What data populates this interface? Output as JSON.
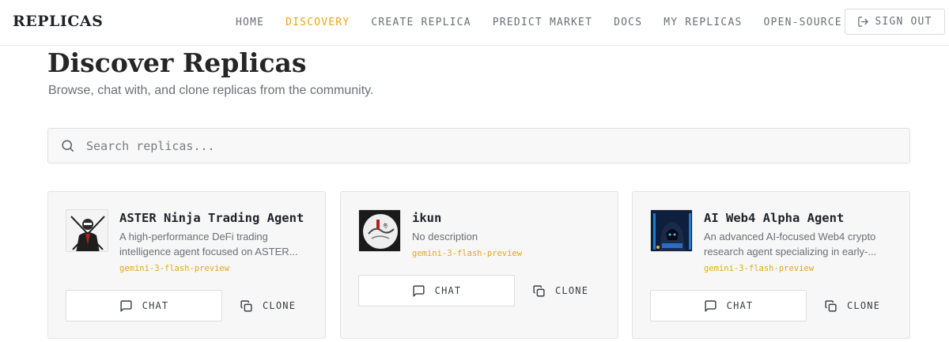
{
  "header": {
    "brand": "REPLICAS",
    "nav": [
      {
        "label": "HOME",
        "active": false
      },
      {
        "label": "DISCOVERY",
        "active": true
      },
      {
        "label": "CREATE REPLICA",
        "active": false
      },
      {
        "label": "PREDICT MARKET",
        "active": false
      },
      {
        "label": "DOCS",
        "active": false
      },
      {
        "label": "MY REPLICAS",
        "active": false
      },
      {
        "label": "OPEN-SOURCE",
        "active": false
      }
    ],
    "signout_label": "SIGN OUT",
    "signout_icon": "log-out-icon"
  },
  "page": {
    "title": "Discover Replicas",
    "subtitle": "Browse, chat with, and clone replicas from the community."
  },
  "search": {
    "placeholder": "Search replicas...",
    "value": "",
    "icon": "search-icon"
  },
  "cards": [
    {
      "name": "ASTER Ninja Trading Agent",
      "description": "A high-performance DeFi trading intelligence agent focused on ASTER...",
      "model": "gemini-3-flash-preview",
      "avatar_icon": "ninja-avatar",
      "chat_label": "CHAT",
      "clone_label": "CLONE"
    },
    {
      "name": "ikun",
      "description": "No description",
      "model": "gemini-3-flash-preview",
      "avatar_icon": "ink-painting-avatar",
      "chat_label": "CHAT",
      "clone_label": "CLONE"
    },
    {
      "name": "AI Web4 Alpha Agent",
      "description": "An advanced AI-focused Web4 crypto research agent specializing in early-...",
      "model": "gemini-3-flash-preview",
      "avatar_icon": "hooded-hacker-avatar",
      "chat_label": "CHAT",
      "clone_label": "CLONE"
    }
  ],
  "colors": {
    "accent": "#e6a817",
    "text": "#1f2328",
    "muted": "#6b6f76",
    "card_bg": "#f7f7f7",
    "border": "#e2e3e5"
  }
}
